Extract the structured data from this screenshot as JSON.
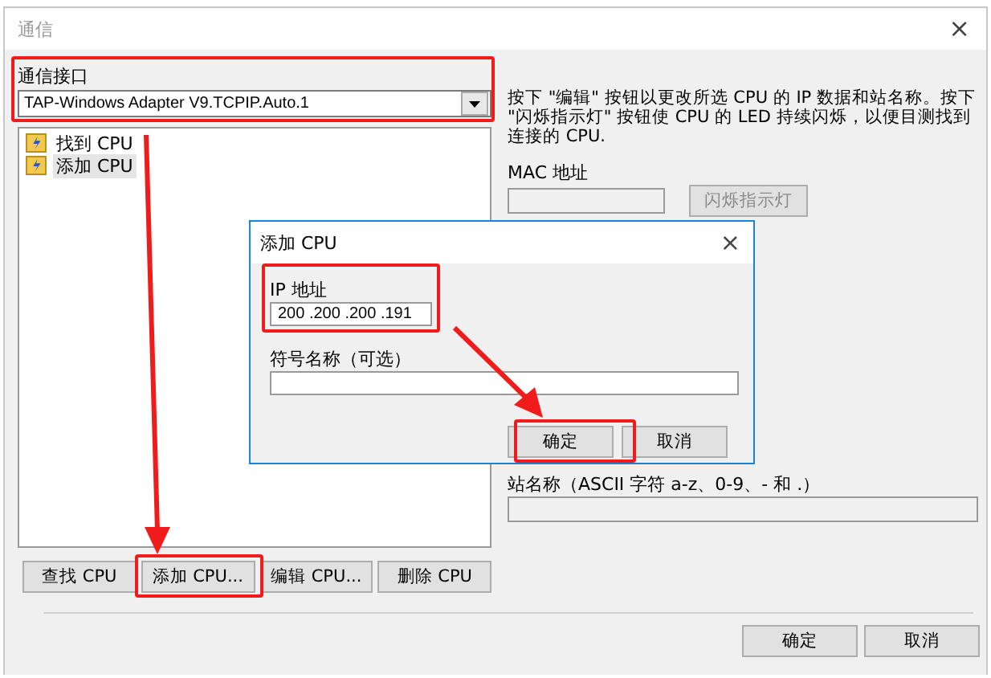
{
  "window": {
    "title": "通信",
    "close": "×"
  },
  "interface": {
    "label": "通信接口",
    "value": "TAP-Windows Adapter V9.TCPIP.Auto.1"
  },
  "cpu_list": [
    {
      "label": "找到 CPU",
      "selected": false
    },
    {
      "label": "添加 CPU",
      "selected": true
    }
  ],
  "list_buttons": [
    "查找 CPU",
    "添加 CPU...",
    "编辑 CPU...",
    "删除 CPU"
  ],
  "info_text": "按下 \"编辑\" 按钮以更改所选 CPU 的 IP 数据和站名称。按下 \"闪烁指示灯\" 按钮使 CPU 的 LED 持续闪烁，以便目测找到连接的 CPU.",
  "mac": {
    "label": "MAC 地址",
    "button": "闪烁指示灯",
    "disabled": true
  },
  "station": {
    "label": "站名称（ASCII 字符 a-z、0-9、- 和 .）"
  },
  "buttons": [
    "确定",
    "取消"
  ],
  "add_cpu_dialog": {
    "title": "添加 CPU",
    "close": "×",
    "ip_label": "IP 地址",
    "ip_value": "200 .200 .200 .191",
    "symbol_label": "符号名称（可选）",
    "buttons": [
      "确定",
      "取消"
    ]
  }
}
